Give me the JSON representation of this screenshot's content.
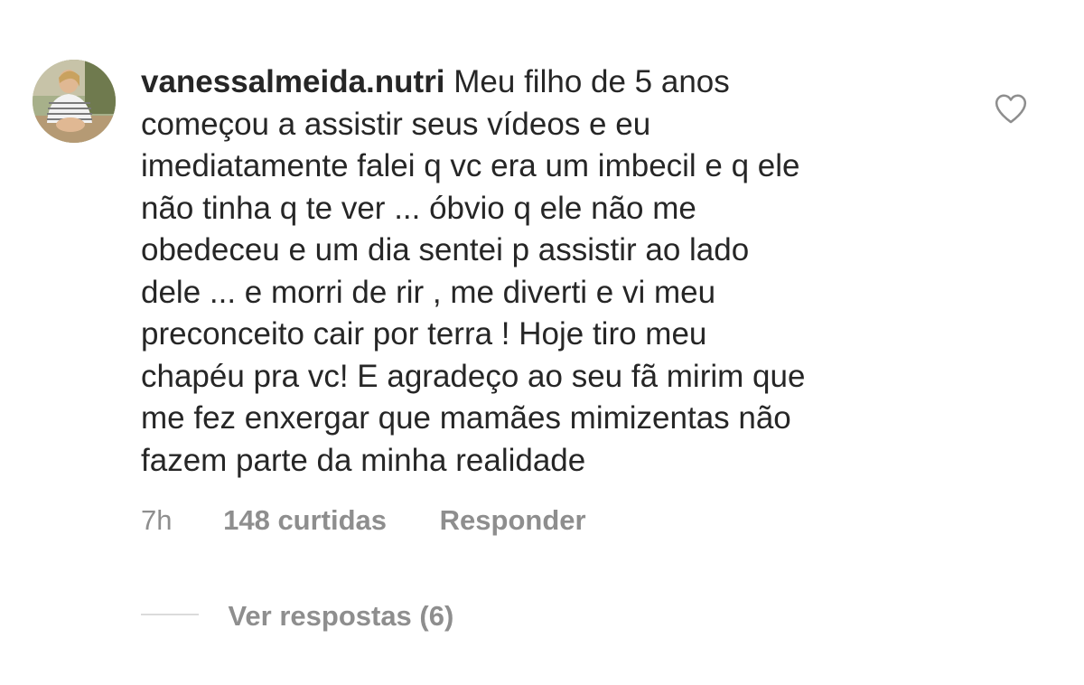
{
  "comment": {
    "username": "vanessalmeida.nutri",
    "text_lines": [
      " Meu filho de 5 anos",
      "começou a assistir seus vídeos e eu",
      "imediatamente falei q vc era um imbecil e q ele",
      "não tinha q te ver ... óbvio q ele não me",
      "obedeceu e um dia sentei p assistir ao lado",
      "dele ... e morri de rir , me diverti e vi meu",
      "preconceito cair por terra ! Hoje tiro meu",
      "chapéu pra vc! E agradeço ao seu fã mirim que",
      "me fez enxergar que mamães mimizentas não",
      "fazem parte da minha realidade"
    ],
    "time": "7h",
    "likes": "148 curtidas",
    "reply_label": "Responder",
    "view_replies_label": "Ver respostas (6)",
    "like_icon": "heart-outline-icon"
  },
  "colors": {
    "text": "#262626",
    "secondary": "#8e8e8e",
    "divider": "#dbdbdb"
  }
}
